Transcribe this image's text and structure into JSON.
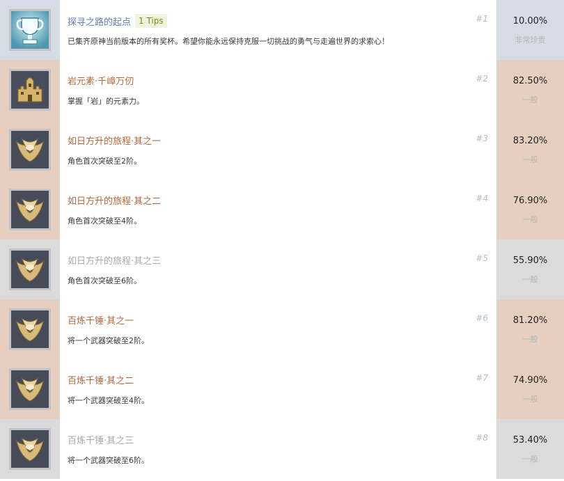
{
  "colors": {
    "legendary_bg": "#d7dbe6",
    "common_bg": "#e7cfc0",
    "unachieved_bg": "#dbdbdb",
    "title_blue": "#5f7fb6",
    "title_orange": "#b2683c",
    "title_grey": "#a9a9a9",
    "tips_green": "#6d8f20"
  },
  "achievements": [
    {
      "title": "探寻之路的起点",
      "tips": "1 Tips",
      "desc": "已集齐原神当前版本的所有奖杯。希望你能永远保持克服一切挑战的勇气与走遍世界的求索心！",
      "rank": "#1",
      "percent": "10.00%",
      "rarity": "非常珍贵",
      "status": "legendary",
      "icon": "trophy-cup-icon"
    },
    {
      "title": "岩元素·千嶂万仞",
      "tips": "",
      "desc": "掌握「岩」的元素力。",
      "rank": "#2",
      "percent": "82.50%",
      "rarity": "一般",
      "status": "common",
      "icon": "castle-icon"
    },
    {
      "title": "如日方升的旅程·其之一",
      "tips": "",
      "desc": "角色首次突破至2阶。",
      "rank": "#3",
      "percent": "83.20%",
      "rarity": "一般",
      "status": "common",
      "icon": "winged-crest-icon"
    },
    {
      "title": "如日方升的旅程·其之二",
      "tips": "",
      "desc": "角色首次突破至4阶。",
      "rank": "#4",
      "percent": "76.90%",
      "rarity": "一般",
      "status": "common",
      "icon": "winged-crest-icon"
    },
    {
      "title": "如日方升的旅程·其之三",
      "tips": "",
      "desc": "角色首次突破至6阶。",
      "rank": "#5",
      "percent": "55.90%",
      "rarity": "一般",
      "status": "unachieved",
      "icon": "winged-crest-icon"
    },
    {
      "title": "百炼千锤·其之一",
      "tips": "",
      "desc": "将一个武器突破至2阶。",
      "rank": "#6",
      "percent": "81.20%",
      "rarity": "一般",
      "status": "common",
      "icon": "winged-crest-icon"
    },
    {
      "title": "百炼千锤·其之二",
      "tips": "",
      "desc": "将一个武器突破至4阶。",
      "rank": "#7",
      "percent": "74.90%",
      "rarity": "一般",
      "status": "common",
      "icon": "winged-crest-icon"
    },
    {
      "title": "百炼千锤·其之三",
      "tips": "",
      "desc": "将一个武器突破至6阶。",
      "rank": "#8",
      "percent": "53.40%",
      "rarity": "一般",
      "status": "unachieved",
      "icon": "winged-crest-icon"
    }
  ]
}
